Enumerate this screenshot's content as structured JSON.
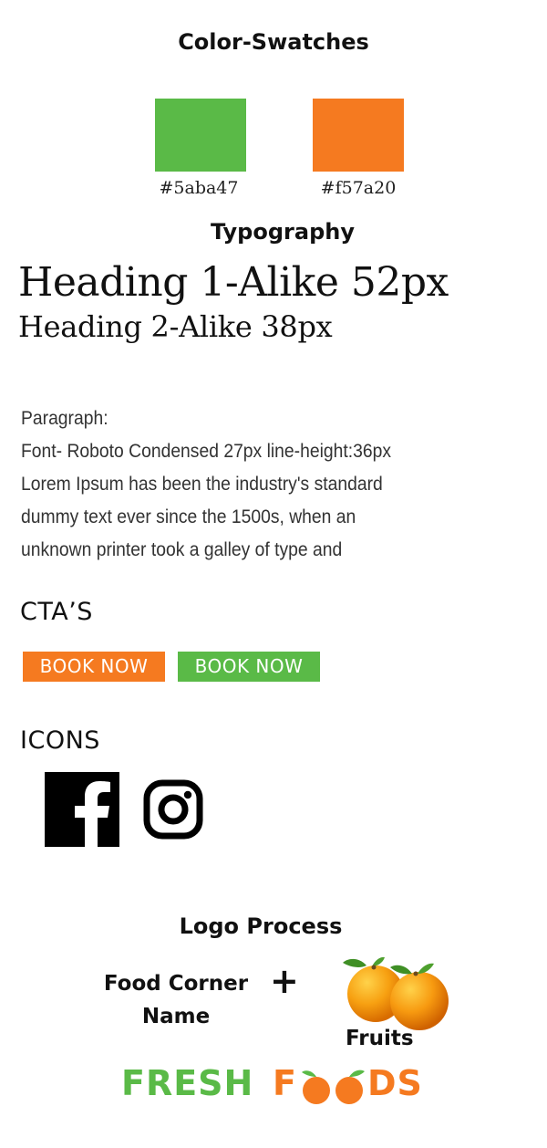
{
  "colors": {
    "green": "#5aba47",
    "orange": "#f57a20"
  },
  "swatches": {
    "title": "Color-Swatches",
    "green_label": "#5aba47",
    "orange_label": "#f57a20"
  },
  "typography": {
    "title": "Typography",
    "heading1": "Heading 1-Alike 52px",
    "heading2": "Heading 2-Alike 38px",
    "paragraph_lines": [
      "Paragraph:",
      "Font- Roboto Condensed 27px line-height:36px",
      "Lorem Ipsum has been the industry's standard",
      "dummy text ever since the 1500s, when an",
      "unknown printer took a galley of type and"
    ]
  },
  "ctas": {
    "title": "CTA’S",
    "orange_button": "BOOK NOW",
    "green_button": "BOOK NOW"
  },
  "icons": {
    "title": "ICONS",
    "items": [
      "facebook-icon",
      "instagram-icon"
    ]
  },
  "logo": {
    "title": "Logo Process",
    "part1_line1": "Food Corner",
    "part1_line2": "Name",
    "plus": "+",
    "fruits_label": "Fruits",
    "brand_word1": "FRESH",
    "brand_word2_start": "F",
    "brand_word2_end": "DS"
  }
}
